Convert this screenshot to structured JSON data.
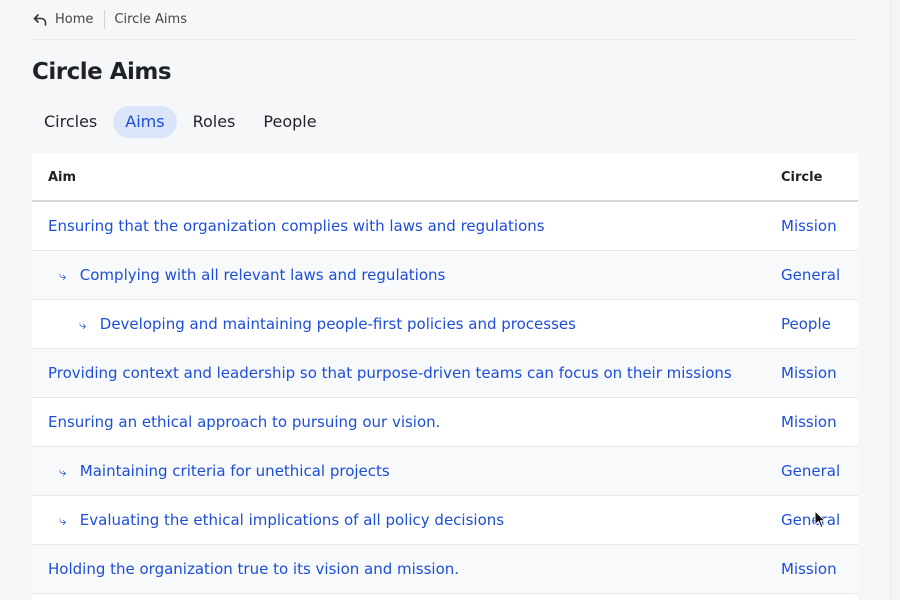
{
  "breadcrumb": {
    "home_label": "Home",
    "current_label": "Circle Aims",
    "icon": "back-arrow-icon"
  },
  "page": {
    "title": "Circle Aims"
  },
  "tabs": [
    {
      "label": "Circles",
      "active": false
    },
    {
      "label": "Aims",
      "active": true
    },
    {
      "label": "Roles",
      "active": false
    },
    {
      "label": "People",
      "active": false
    }
  ],
  "table": {
    "columns": {
      "aim": "Aim",
      "circle": "Circle"
    },
    "rows": [
      {
        "aim": "Ensuring that the organization complies with laws and regulations",
        "circle": "Mission",
        "level": 0
      },
      {
        "aim": "Complying with all relevant laws and regulations",
        "circle": "General",
        "level": 1
      },
      {
        "aim": "Developing and maintaining people-first policies and processes",
        "circle": "People",
        "level": 2
      },
      {
        "aim": "Providing context and leadership so that purpose-driven teams can focus on their missions",
        "circle": "Mission",
        "level": 0
      },
      {
        "aim": "Ensuring an ethical approach to pursuing our vision.",
        "circle": "Mission",
        "level": 0
      },
      {
        "aim": "Maintaining criteria for unethical projects",
        "circle": "General",
        "level": 1
      },
      {
        "aim": "Evaluating the ethical implications of all policy decisions",
        "circle": "General",
        "level": 1
      },
      {
        "aim": "Holding the organization true to its vision and mission.",
        "circle": "Mission",
        "level": 0
      }
    ],
    "sub_marker": "⤷"
  },
  "colors": {
    "accent": "#1d4ed8",
    "active_tab_bg": "#dbe5fa",
    "page_bg": "#f6f7f9"
  }
}
